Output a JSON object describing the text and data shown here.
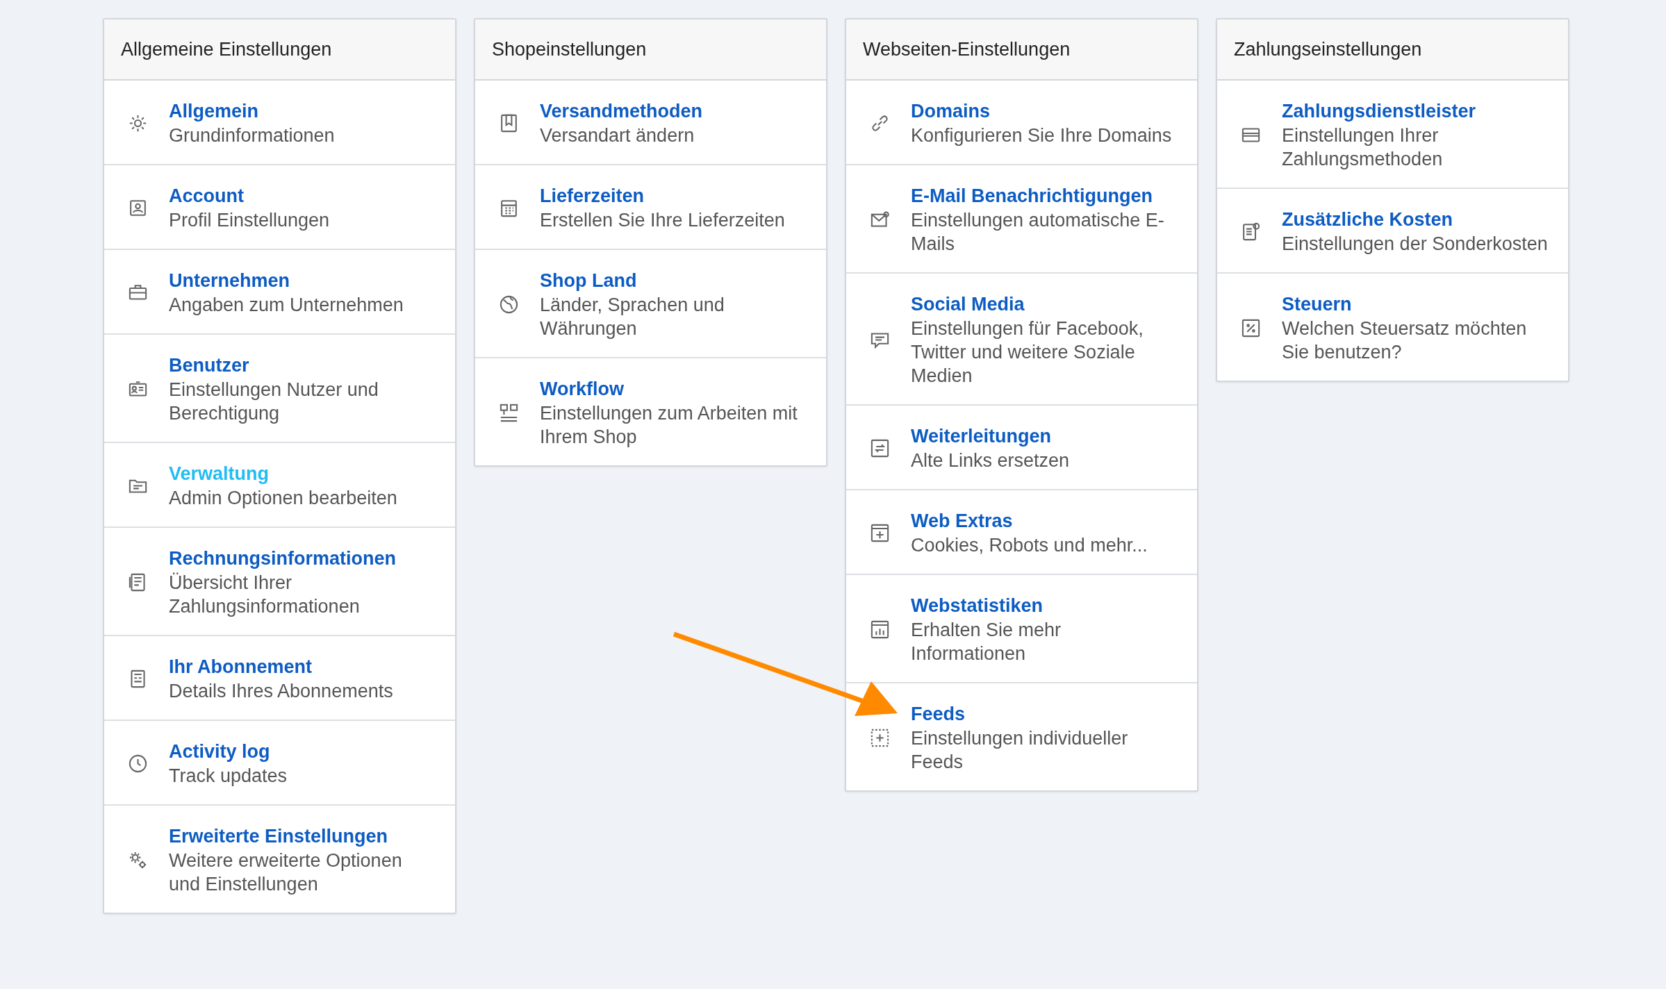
{
  "columns": [
    {
      "title": "Allgemeine Einstellungen",
      "items": [
        {
          "title": "Allgemein",
          "description": "Grundinformationen",
          "highlighted": false
        },
        {
          "title": "Account",
          "description": "Profil Einstellungen",
          "highlighted": false
        },
        {
          "title": "Unternehmen",
          "description": "Angaben zum Unternehmen",
          "highlighted": false
        },
        {
          "title": "Benutzer",
          "description": "Einstellungen Nutzer und Berechtigung",
          "highlighted": false
        },
        {
          "title": "Verwaltung",
          "description": "Admin Optionen bearbeiten",
          "highlighted": true
        },
        {
          "title": "Rechnungsinformationen",
          "description": "Übersicht Ihrer Zahlungsinformationen",
          "highlighted": false
        },
        {
          "title": "Ihr Abonnement",
          "description": "Details Ihres Abonnements",
          "highlighted": false
        },
        {
          "title": "Activity log",
          "description": "Track updates",
          "highlighted": false
        },
        {
          "title": "Erweiterte Einstellungen",
          "description": "Weitere erweiterte Optionen und Einstellungen",
          "highlighted": false
        }
      ]
    },
    {
      "title": "Shopeinstellungen",
      "items": [
        {
          "title": "Versandmethoden",
          "description": "Versandart ändern",
          "highlighted": false
        },
        {
          "title": "Lieferzeiten",
          "description": "Erstellen Sie Ihre Lieferzeiten",
          "highlighted": false
        },
        {
          "title": "Shop Land",
          "description": "Länder, Sprachen und Währungen",
          "highlighted": false
        },
        {
          "title": "Workflow",
          "description": "Einstellungen zum Arbeiten mit Ihrem Shop",
          "highlighted": false
        }
      ]
    },
    {
      "title": "Webseiten-Einstellungen",
      "items": [
        {
          "title": "Domains",
          "description": "Konfigurieren Sie Ihre Domains",
          "highlighted": false
        },
        {
          "title": "E-Mail Benachrichtigungen",
          "description": "Einstellungen automatische E-Mails",
          "highlighted": false
        },
        {
          "title": "Social Media",
          "description": "Einstellungen für Facebook, Twitter und weitere Soziale Medien",
          "highlighted": false
        },
        {
          "title": "Weiterleitungen",
          "description": "Alte Links ersetzen",
          "highlighted": false
        },
        {
          "title": "Web Extras",
          "description": "Cookies, Robots und mehr...",
          "highlighted": false
        },
        {
          "title": "Webstatistiken",
          "description": "Erhalten Sie mehr Informationen",
          "highlighted": false
        },
        {
          "title": "Feeds",
          "description": "Einstellungen individueller Feeds",
          "highlighted": false
        }
      ]
    },
    {
      "title": "Zahlungseinstellungen",
      "items": [
        {
          "title": "Zahlungsdienstleister",
          "description": "Einstellungen Ihrer Zahlungsmethoden",
          "highlighted": false
        },
        {
          "title": "Zusätzliche Kosten",
          "description": "Einstellungen der Sonderkosten",
          "highlighted": false
        },
        {
          "title": "Steuern",
          "description": "Welchen Steuersatz möchten Sie benutzen?",
          "highlighted": false
        }
      ]
    }
  ]
}
